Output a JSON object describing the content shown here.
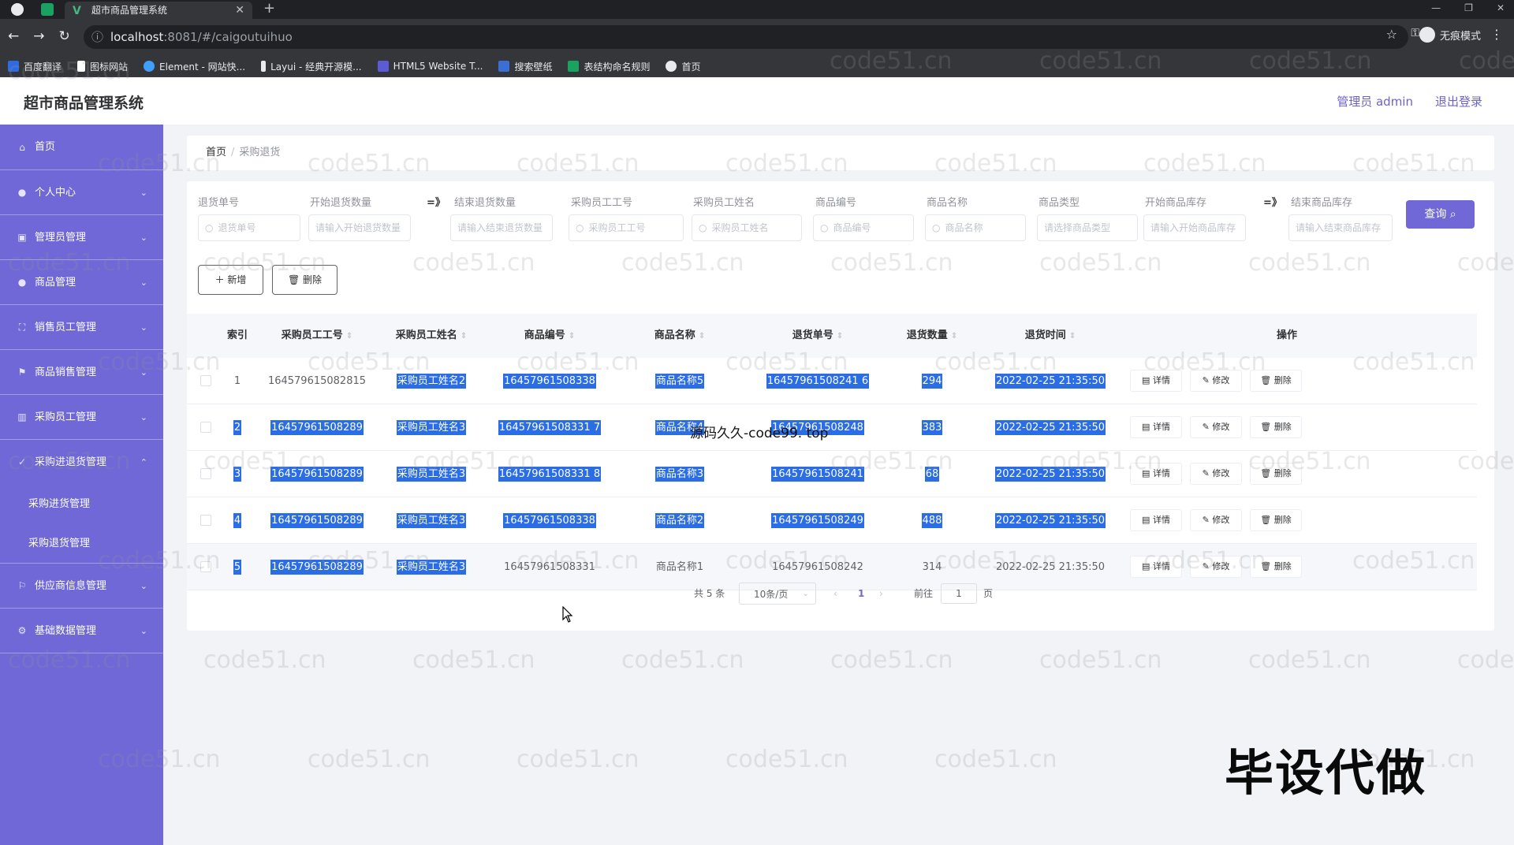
{
  "browser": {
    "tab_title": "超市商品管理系统",
    "url_host": "localhost",
    "url_port": ":8081",
    "url_path": "/#/caigoutuihuo",
    "incognito_label": "无痕模式",
    "bookmarks": [
      {
        "label": "百度翻译",
        "color": "#2f6be0"
      },
      {
        "label": "图标网站",
        "color": "#ffffff"
      },
      {
        "label": "Element - 网站快...",
        "color": "#409eff"
      },
      {
        "label": "Layui - 经典开源模...",
        "color": "#e8eaed"
      },
      {
        "label": "HTML5 Website T...",
        "color": "#5b5bd6"
      },
      {
        "label": "搜索壁纸",
        "color": "#3b6fd4"
      },
      {
        "label": "表结构命名规则",
        "color": "#1aa260"
      },
      {
        "label": "首页",
        "color": "#e8eaed"
      }
    ]
  },
  "header": {
    "title": "超市商品管理系统",
    "admin_label": "管理员 admin",
    "logout_label": "退出登录"
  },
  "sidebar": {
    "items": [
      {
        "label": "首页",
        "icon": "home-icon",
        "expandable": false
      },
      {
        "label": "个人中心",
        "icon": "user-icon",
        "expandable": true
      },
      {
        "label": "管理员管理",
        "icon": "admin-icon",
        "expandable": true
      },
      {
        "label": "商品管理",
        "icon": "user-icon",
        "expandable": true
      },
      {
        "label": "销售员工管理",
        "icon": "grid-icon",
        "expandable": true
      },
      {
        "label": "商品销售管理",
        "icon": "flag-icon",
        "expandable": true
      },
      {
        "label": "采购员工管理",
        "icon": "chart-icon",
        "expandable": true
      },
      {
        "label": "采购进退货管理",
        "icon": "check-icon",
        "expandable": true,
        "open": true
      },
      {
        "label": "供应商信息管理",
        "icon": "shop-icon",
        "expandable": true
      },
      {
        "label": "基础数据管理",
        "icon": "gear-icon",
        "expandable": true
      }
    ],
    "submenu": [
      "采购进货管理",
      "采购退货管理"
    ]
  },
  "breadcrumb": {
    "home": "首页",
    "current": "采购退货"
  },
  "filters": {
    "labels": [
      "退货单号",
      "开始退货数量",
      "结束退货数量",
      "采购员工工号",
      "采购员工姓名",
      "商品编号",
      "商品名称",
      "商品类型",
      "开始商品库存",
      "结束商品库存"
    ],
    "arrow": "=》",
    "placeholders": [
      "退货单号",
      "请输入开始退货数量",
      "请输入结束退货数量",
      "采购员工工号",
      "采购员工姓名",
      "商品编号",
      "商品名称",
      "请选择商品类型",
      "请输入开始商品库存",
      "请输入结束商品库存"
    ],
    "query_label": "查询"
  },
  "toolbar": {
    "add_label": "新增",
    "delete_label": "删除"
  },
  "table": {
    "columns": [
      "索引",
      "采购员工工号",
      "采购员工姓名",
      "商品编号",
      "商品名称",
      "退货单号",
      "退货数量",
      "退货时间",
      "操作"
    ],
    "rows": [
      [
        "1",
        "164579615082815",
        "采购员工姓名2",
        "16457961508338",
        "商品名称5",
        "16457961508241 6",
        "294",
        "2022-02-25 21:35:50"
      ],
      [
        "2",
        "16457961508289",
        "采购员工姓名3",
        "16457961508331 7",
        "商品名称4",
        "16457961508248",
        "383",
        "2022-02-25 21:35:50"
      ],
      [
        "3",
        "16457961508289",
        "采购员工姓名3",
        "16457961508331 8",
        "商品名称3",
        "16457961508241",
        "68",
        "2022-02-25 21:35:50"
      ],
      [
        "4",
        "16457961508289",
        "采购员工姓名3",
        "16457961508338",
        "商品名称2",
        "16457961508249",
        "488",
        "2022-02-25 21:35:50"
      ],
      [
        "5",
        "16457961508289",
        "采购员工姓名3",
        "16457961508331",
        "商品名称1",
        "16457961508242",
        "314",
        "2022-02-25 21:35:50"
      ]
    ],
    "actions": [
      "详情",
      "修改",
      "删除"
    ]
  },
  "pagination": {
    "total_label": "共 5 条",
    "page_size": "10条/页",
    "current_page": "1",
    "goto_label": "前往",
    "goto_value": "1",
    "page_unit": "页"
  },
  "overlay": {
    "watermark": "code51.cn",
    "source_note": "源码久久-code99. top",
    "banner": "毕设代做"
  },
  "colors": {
    "accent": "#6f68d6",
    "selection": "#2b6de5"
  }
}
